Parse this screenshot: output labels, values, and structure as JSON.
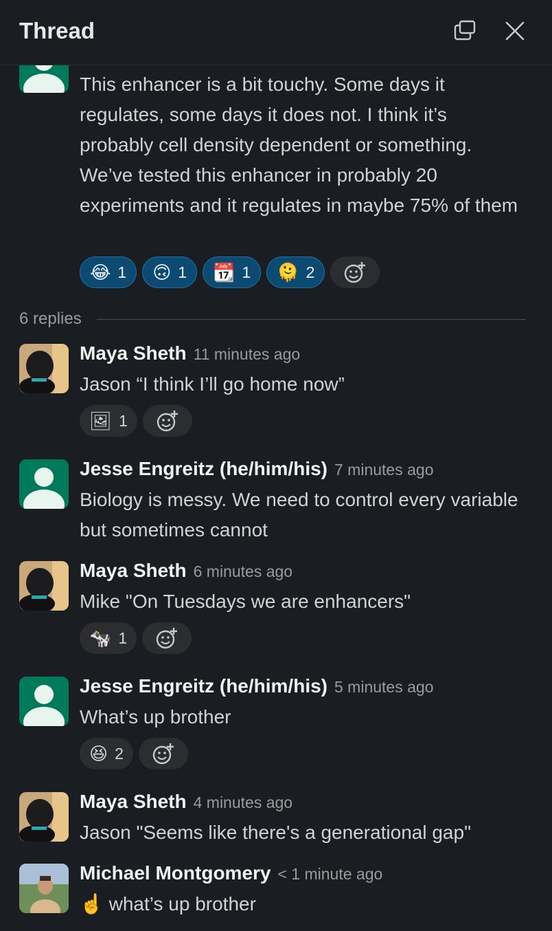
{
  "header": {
    "title": "Thread"
  },
  "parent": {
    "text": "This enhancer is a bit touchy. Some days it regulates, some days it does not. I think it’s probably cell density dependent or something. We’ve tested this enhancer in probably 20 experiments and it regulates in maybe 75% of them",
    "reactions": [
      {
        "emoji": "😂",
        "count": "1"
      },
      {
        "emoji": "🙃",
        "count": "1"
      },
      {
        "emoji": "📆",
        "count": "1"
      },
      {
        "emoji": "🫠",
        "count": "2"
      }
    ]
  },
  "replies_label": "6 replies",
  "messages": [
    {
      "name": "Maya Sheth",
      "time": "11 minutes ago",
      "text": "Jason “I think I’ll go home now”",
      "reactions": [
        {
          "emoji": "🖼",
          "count": "1"
        }
      ]
    },
    {
      "name": "Jesse Engreitz (he/him/his)",
      "time": "7 minutes ago",
      "text": "Biology is messy. We need to control every variable but sometimes cannot"
    },
    {
      "name": "Maya Sheth",
      "time": "6 minutes ago",
      "text": "Mike \"On Tuesdays we are enhancers\"",
      "reactions": [
        {
          "emoji": "🐄",
          "count": "1"
        }
      ]
    },
    {
      "name": "Jesse Engreitz (he/him/his)",
      "time": "5 minutes ago",
      "text": "What’s up brother",
      "reactions": [
        {
          "emoji": "😆",
          "count": "2"
        }
      ]
    },
    {
      "name": "Maya Sheth",
      "time": "4 minutes ago",
      "text": "Jason \"Seems like there's a generational gap\""
    },
    {
      "name": "Michael Montgomery",
      "time": "< 1 minute ago",
      "text": "☝️ what’s up brother"
    }
  ]
}
